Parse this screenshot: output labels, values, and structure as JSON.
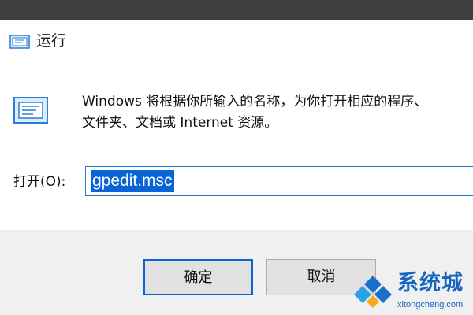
{
  "window": {
    "title": "运行",
    "title_icon": "run-app-icon"
  },
  "content": {
    "icon": "run-app-icon",
    "description": "Windows 将根据你所输入的名称，为你打开相应的程序、\n文件夹、文档或 Internet 资源。"
  },
  "open_field": {
    "label": "打开(O):",
    "value": "gpedit.msc"
  },
  "buttons": {
    "ok_label": "确定",
    "cancel_label": "取消"
  },
  "watermark": {
    "title": "系统城",
    "subtitle": "xitongcheng.com"
  },
  "colors": {
    "accent": "#0a64d6",
    "watermark": "#1565c0"
  }
}
